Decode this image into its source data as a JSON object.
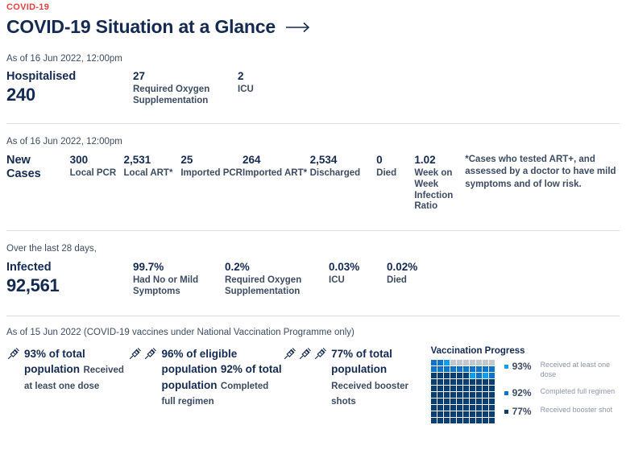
{
  "header": {
    "eyebrow": "COVID-19",
    "title": "COVID-19 Situation at a Glance",
    "arrow_icon": "arrow-right-icon"
  },
  "hospitalised": {
    "asof": "As of 16 Jun 2022, 12:00pm",
    "label": "Hospitalised",
    "value": "240",
    "metrics": [
      {
        "value": "27",
        "caption": "Required Oxygen Supplementation"
      },
      {
        "value": "2",
        "caption": "ICU"
      }
    ]
  },
  "new_cases": {
    "asof": "As of 16 Jun 2022, 12:00pm",
    "label_line1": "New",
    "label_line2": "Cases",
    "metrics": [
      {
        "value": "300",
        "caption": "Local PCR"
      },
      {
        "value": "2,531",
        "caption": "Local ART*"
      },
      {
        "value": "25",
        "caption": "Imported PCR"
      },
      {
        "value": "264",
        "caption": "Imported ART*"
      },
      {
        "value": "2,534",
        "caption": "Discharged"
      },
      {
        "value": "0",
        "caption": "Died"
      },
      {
        "value": "1.02",
        "caption": "Week on Week Infection Ratio"
      }
    ],
    "footnote": "*Cases who tested ART+, and assessed by a doctor to have mild symptoms and of low risk."
  },
  "infected": {
    "asof": "Over the last 28 days,",
    "label": "Infected",
    "value": "92,561",
    "metrics": [
      {
        "value": "99.7%",
        "caption": "Had No or Mild Symptoms"
      },
      {
        "value": "0.2%",
        "caption": "Required Oxygen Supplementation"
      },
      {
        "value": "0.03%",
        "caption": "ICU"
      },
      {
        "value": "0.02%",
        "caption": "Died"
      }
    ]
  },
  "vaccination": {
    "asof": "As of 15 Jun 2022 (COVID-19 vaccines under National Vaccination Programme only)",
    "columns": [
      {
        "syringe_count": 1,
        "icon": "syringe-icon",
        "highlight1": "93% of total population",
        "highlight2": "",
        "sub1": "Received at least one dose",
        "sub2": ""
      },
      {
        "syringe_count": 2,
        "icon": "syringe-icon",
        "highlight1": "96% of eligible population",
        "highlight2": "92% of total population",
        "sub1": "",
        "sub2": "Completed full regimen"
      },
      {
        "syringe_count": 3,
        "icon": "syringe-icon",
        "highlight1": "77% of total population",
        "highlight2": "",
        "sub1": "Received booster shots",
        "sub2": ""
      }
    ]
  },
  "chart_data": {
    "type": "waffle",
    "title": "Vaccination Progress",
    "unit": "percent of population",
    "grid": {
      "rows": 10,
      "cols": 10,
      "total_cells": 100
    },
    "series": [
      {
        "name": "Received at least one dose",
        "value": 93,
        "label": "93%",
        "desc": "Received at least one dose",
        "color": "#0d9ded"
      },
      {
        "name": "Completed full regimen",
        "value": 92,
        "label": "92%",
        "desc": "Completed full regimen",
        "color": "#1073c6"
      },
      {
        "name": "Received booster shot",
        "value": 77,
        "label": "77%",
        "desc": "Received booster shot",
        "color": "#0b3e70"
      }
    ],
    "empty_value": 7,
    "empty_color": "#c3c8cd",
    "cells": [
      "#1073c6",
      "#1073c6",
      "#0d9ded",
      "#c3c8cd",
      "#c3c8cd",
      "#c3c8cd",
      "#c3c8cd",
      "#c3c8cd",
      "#c3c8cd",
      "#c3c8cd",
      "#1073c6",
      "#1073c6",
      "#1073c6",
      "#1073c6",
      "#1073c6",
      "#1073c6",
      "#1073c6",
      "#1073c6",
      "#1073c6",
      "#1073c6",
      "#0b3e70",
      "#0b3e70",
      "#0b3e70",
      "#0b3e70",
      "#0b3e70",
      "#0b3e70",
      "#0d9ded",
      "#1073c6",
      "#0d9ded",
      "#1073c6",
      "#0b3e70",
      "#0b3e70",
      "#0b3e70",
      "#0b3e70",
      "#0b3e70",
      "#0b3e70",
      "#0b3e70",
      "#0b3e70",
      "#0b3e70",
      "#0b3e70",
      "#0b3e70",
      "#0b3e70",
      "#0b3e70",
      "#0b3e70",
      "#0b3e70",
      "#0b3e70",
      "#0b3e70",
      "#0b3e70",
      "#0b3e70",
      "#0b3e70",
      "#0b3e70",
      "#0b3e70",
      "#0b3e70",
      "#0b3e70",
      "#0b3e70",
      "#0b3e70",
      "#0b3e70",
      "#0b3e70",
      "#0b3e70",
      "#0b3e70",
      "#0b3e70",
      "#0b3e70",
      "#0b3e70",
      "#0b3e70",
      "#0b3e70",
      "#0b3e70",
      "#0b3e70",
      "#0b3e70",
      "#0b3e70",
      "#0b3e70",
      "#0b3e70",
      "#0b3e70",
      "#0b3e70",
      "#0b3e70",
      "#0b3e70",
      "#0b3e70",
      "#0b3e70",
      "#0b3e70",
      "#0b3e70",
      "#0b3e70",
      "#0b3e70",
      "#0b3e70",
      "#0b3e70",
      "#0b3e70",
      "#0b3e70",
      "#0b3e70",
      "#0b3e70",
      "#0b3e70",
      "#0b3e70",
      "#0b3e70",
      "#0b3e70",
      "#0b3e70",
      "#0b3e70",
      "#0b3e70",
      "#0b3e70",
      "#0b3e70",
      "#0b3e70",
      "#0b3e70",
      "#0b3e70",
      "#0b3e70"
    ]
  }
}
